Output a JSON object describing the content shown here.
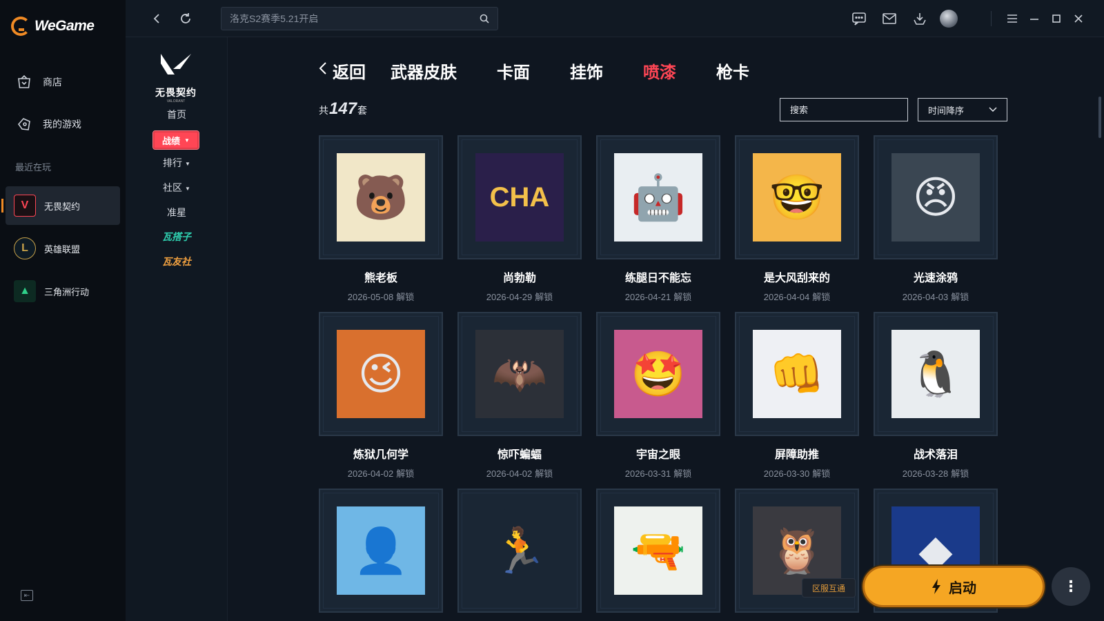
{
  "app": {
    "brand": "WeGame",
    "sidebar": {
      "nav": [
        {
          "label": "商店",
          "icon": "bag-icon"
        },
        {
          "label": "我的游戏",
          "icon": "gamepad-icon"
        }
      ],
      "recent_label": "最近在玩",
      "games": [
        {
          "label": "无畏契约",
          "icon": "valorant-icon",
          "active": true
        },
        {
          "label": "英雄联盟",
          "icon": "league-icon",
          "active": false
        },
        {
          "label": "三角洲行动",
          "icon": "delta-force-icon",
          "active": false
        }
      ]
    }
  },
  "topbar": {
    "search_placeholder": "洛克S2赛季5.21开启",
    "icons": [
      "back-icon",
      "refresh-icon",
      "chat-icon",
      "mail-icon",
      "download-icon",
      "avatar",
      "menu-icon",
      "minimize-icon",
      "maximize-icon",
      "close-icon"
    ]
  },
  "game_nav": {
    "logo_name": "无畏契约",
    "logo_sub": "VALORANT",
    "home": "首页",
    "battle": "战绩",
    "rank": "排行",
    "community": "社区",
    "crosshair": "准星",
    "wagezi": "瓦搭子",
    "wayoushe": "瓦友社"
  },
  "main": {
    "back_label": "返回",
    "tabs": [
      {
        "label": "武器皮肤",
        "active": false
      },
      {
        "label": "卡面",
        "active": false
      },
      {
        "label": "挂饰",
        "active": false
      },
      {
        "label": "喷漆",
        "active": true
      },
      {
        "label": "枪卡",
        "active": false
      }
    ],
    "count_prefix": "共",
    "count": "147",
    "count_suffix": "套",
    "search_placeholder": "搜索",
    "sort_label": "时间降序",
    "unlock_suffix": "解锁",
    "items": [
      {
        "title": "熊老板",
        "date": "2026-05-08",
        "glyph": "🐻",
        "bg": "#f1e7c8"
      },
      {
        "title": "尚勃勒",
        "date": "2026-04-29",
        "glyph": "CHA",
        "bg": "#2a1f4a"
      },
      {
        "title": "练腿日不能忘",
        "date": "2026-04-21",
        "glyph": "🤖",
        "bg": "#e9eef2"
      },
      {
        "title": "是大风刮来的",
        "date": "2026-04-04",
        "glyph": "🤓",
        "bg": "#f4b64a"
      },
      {
        "title": "光速涂鸦",
        "date": "2026-04-03",
        "glyph": "😠",
        "bg": "#3a4652"
      },
      {
        "title": "炼狱几何学",
        "date": "2026-04-02",
        "glyph": "😉",
        "bg": "#d9702e"
      },
      {
        "title": "惊吓蝙蝠",
        "date": "2026-04-02",
        "glyph": "🦇",
        "bg": "#2c3038"
      },
      {
        "title": "宇宙之眼",
        "date": "2026-03-31",
        "glyph": "🤩",
        "bg": "#c85a8e"
      },
      {
        "title": "屏障助推",
        "date": "2026-03-30",
        "glyph": "👊",
        "bg": "#eef0f4"
      },
      {
        "title": "战术落泪",
        "date": "2026-03-28",
        "glyph": "🐧",
        "bg": "#e9edf0"
      },
      {
        "title": "",
        "date": "",
        "glyph": "👤",
        "bg": "#6fb7e6"
      },
      {
        "title": "",
        "date": "",
        "glyph": "🏃",
        "bg": "#1a2634"
      },
      {
        "title": "",
        "date": "",
        "glyph": "🔫",
        "bg": "#eef2ee"
      },
      {
        "title": "",
        "date": "",
        "glyph": "🦉",
        "bg": "#3a3a40"
      },
      {
        "title": "",
        "date": "",
        "glyph": "◆",
        "bg": "#1a3a8a"
      }
    ]
  },
  "launch": {
    "region_label": "区服互通",
    "button_label": "启动"
  },
  "colors": {
    "accent": "#ff4655",
    "launch": "#f5a623",
    "wegame_orange": "#f08a24"
  }
}
